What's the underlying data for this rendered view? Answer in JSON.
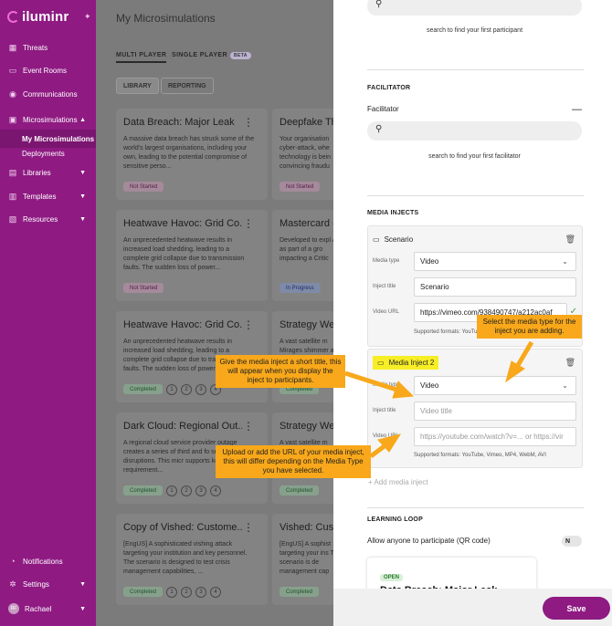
{
  "sidebar": {
    "logo": "iluminr",
    "items": [
      {
        "label": "Threats",
        "icon": "grid-icon"
      },
      {
        "label": "Event Rooms",
        "icon": "chat-icon"
      },
      {
        "label": "Communications",
        "icon": "broadcast-icon"
      },
      {
        "label": "Microsimulations",
        "icon": "briefcase-icon"
      },
      {
        "label": "My Microsimulations"
      },
      {
        "label": "Deployments"
      },
      {
        "label": "Libraries",
        "icon": "book-icon"
      },
      {
        "label": "Templates",
        "icon": "template-icon"
      },
      {
        "label": "Resources",
        "icon": "resources-icon"
      }
    ],
    "bottom": [
      {
        "label": "Notifications",
        "icon": "bell-icon"
      },
      {
        "label": "Settings",
        "icon": "gear-icon"
      },
      {
        "label": "Rachael",
        "initials": "RF"
      }
    ]
  },
  "main": {
    "title": "My Microsimulations",
    "tabs": [
      "MULTI PLAYER",
      "SINGLE PLAYER"
    ],
    "beta": "BETA",
    "filters": [
      "LIBRARY",
      "REPORTING"
    ],
    "cards": [
      {
        "title": "Data Breach: Major Leak",
        "desc": "A massive data breach has struck some of the world's largest organisations, including your own, leading to the potential compromise of sensitive perso...",
        "status": "Not Started"
      },
      {
        "title": "Deepfake Th",
        "desc": "Your organisation cyber-attack, whe technology is bein convincing fraudu",
        "status": "Not Started"
      },
      {
        "title": "Heatwave Havoc: Grid Co...",
        "desc": "An unprecedented heatwave results in increased load shedding, leading to a complete grid collapse due to transmission faults. The sudden loss of power...",
        "status": "Not Started"
      },
      {
        "title": "Mastercard -",
        "desc": "Developed to expl AI as part of a gro impacting a Critic",
        "status": "In Progress"
      },
      {
        "title": "Heatwave Havoc: Grid Co...",
        "desc": "An unprecedented heatwave results in increased load shedding, leading to a complete grid collapse due to transmission faults. The sudden loss of power...",
        "status": "Completed",
        "steps": [
          "1",
          "2",
          "3",
          "4"
        ]
      },
      {
        "title": "Strategy Wee",
        "desc": "A vast satellite m Mirages shimmer a strategy week to p",
        "status": "Completed"
      },
      {
        "title": "Dark Cloud: Regional Out...",
        "desc": "A regional cloud service provider outage creates a series of third and fo service disruptions. This micr supports key requirement...",
        "status": "Completed",
        "steps": [
          "1",
          "2",
          "3",
          "4"
        ]
      },
      {
        "title": "Strategy Wee",
        "desc": "A vast satellite m strategy week to p",
        "status": "Completed"
      },
      {
        "title": "Copy of Vished: Custome...",
        "desc": "[EngUS] A sophisticated vishing attack targeting your institution and key personnel. The scenario is designed to test crisis management capabilities, ...",
        "status": "Completed",
        "steps": [
          "1",
          "2",
          "3",
          "4"
        ]
      },
      {
        "title": "Vished: Cust",
        "desc": "[EngUS] A sophist targeting your ins The scenario is de management cap",
        "status": "Completed"
      }
    ]
  },
  "panel": {
    "participant_hint": "search to find your first participant",
    "facilitator_heading": "FACILITATOR",
    "facilitator_label": "Facilitator",
    "facilitator_hint": "search to find your first facilitator",
    "media_heading": "MEDIA INJECTS",
    "inject1": {
      "name": "Scenario",
      "type_label": "Media type",
      "type_value": "Video",
      "title_label": "Inject title",
      "title_value": "Scenario",
      "url_label": "Video URL",
      "url_value": "https://vimeo.com/938490747/a212ac0af",
      "formats": "Supported formats: YouTu"
    },
    "inject2": {
      "name": "Media Inject 2",
      "type_label": "Media type",
      "type_value": "Video",
      "title_label": "Inject title",
      "title_placeholder": "Video title",
      "url_label": "Video URL",
      "url_placeholder": "https://youtube.com/watch?v=... or https://vir",
      "formats": "Supported formats: YouTube, Vimeo, MP4, WebM, AVI"
    },
    "add_inject": "+ Add media inject",
    "learning_heading": "LEARNING LOOP",
    "allow_label": "Allow anyone to participate (QR code)",
    "toggle_value": "N",
    "mini_card": {
      "badge": "OPEN",
      "title": "Data Breach: Major Leak"
    },
    "save": "Save"
  },
  "callouts": {
    "media_type": "Select the media type for the inject you are adding.",
    "title": "Give the media inject a short title, this will appear when you display the inject to participants.",
    "url": "Upload or add the URL of your media inject, this will differ depending on the Media Type you have selected."
  }
}
